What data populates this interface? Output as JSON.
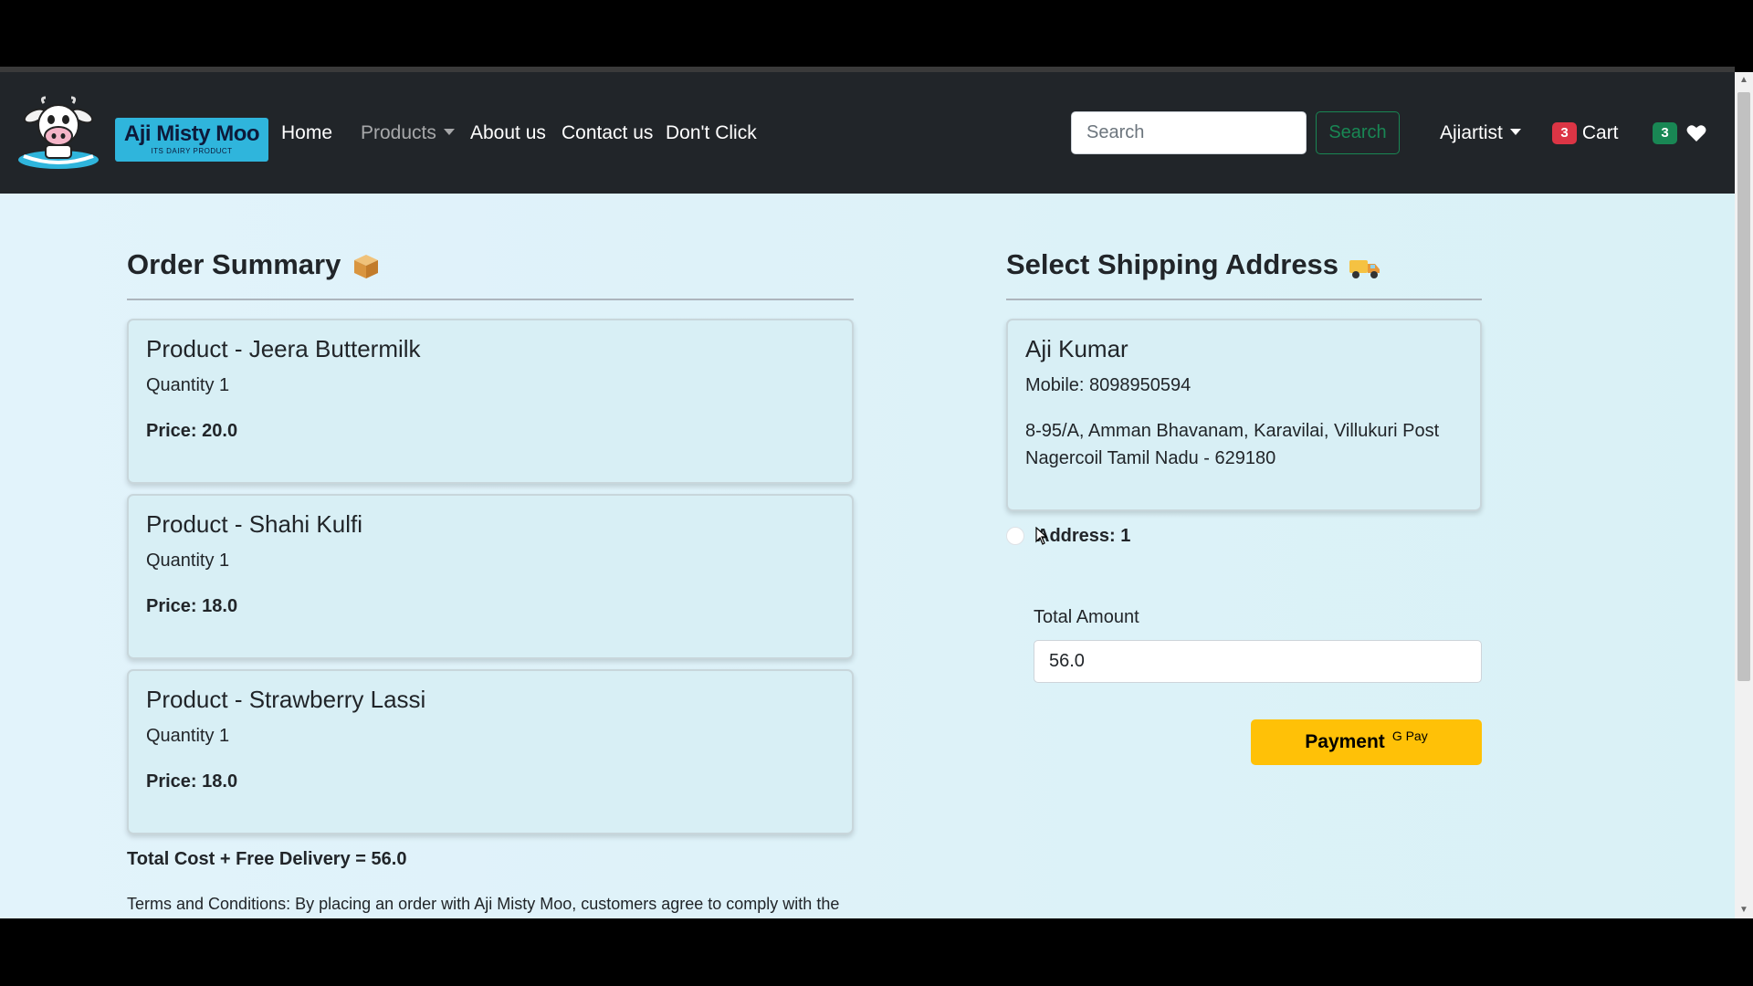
{
  "navbar": {
    "brand_title": "Aji Misty Moo",
    "brand_subtitle": "ITS DAIRY PRODUCT",
    "links": {
      "home": "Home",
      "products": "Products",
      "about": "About us",
      "contact": "Contact us",
      "dont_click": "Don't Click"
    },
    "search_placeholder": "Search",
    "search_button": "Search",
    "user_menu": "Ajiartist",
    "cart_count": "3",
    "cart_label": "Cart",
    "wishlist_count": "3"
  },
  "order_summary": {
    "title": "Order Summary",
    "items": [
      {
        "name": "Product - Jeera Buttermilk",
        "quantity": "Quantity 1",
        "price": "Price: 20.0"
      },
      {
        "name": "Product - Shahi Kulfi",
        "quantity": "Quantity 1",
        "price": "Price: 18.0"
      },
      {
        "name": "Product - Strawberry Lassi",
        "quantity": "Quantity 1",
        "price": "Price: 18.0"
      }
    ],
    "total_cost": "Total Cost + Free Delivery = 56.0",
    "terms": "Terms and Conditions: By placing an order with Aji Misty Moo, customers agree to comply with the"
  },
  "shipping": {
    "title": "Select Shipping Address",
    "address": {
      "name": "Aji Kumar",
      "mobile": "Mobile: 8098950594",
      "line1": "8-95/A, Amman Bhavanam, Karavilai, Villukuri Post",
      "line2": "Nagercoil Tamil Nadu - 629180"
    },
    "radio_label": "Address: 1",
    "total_amount_label": "Total Amount",
    "total_amount_value": "56.0",
    "payment_label": "Payment",
    "gpay_label": "G Pay"
  },
  "colors": {
    "navbar_bg": "#212529",
    "page_bg": "#dcf1f8",
    "brand_bg": "#2fb5dc",
    "search_green": "#198754",
    "cart_badge": "#dc3545",
    "wish_badge": "#198754",
    "pay_button": "#ffc107"
  },
  "icons": {
    "logo": "cow-logo-icon",
    "order": "package-icon",
    "shipping": "delivery-truck-icon",
    "wishlist": "heart-icon",
    "cursor": "mouse-pointer-icon"
  }
}
